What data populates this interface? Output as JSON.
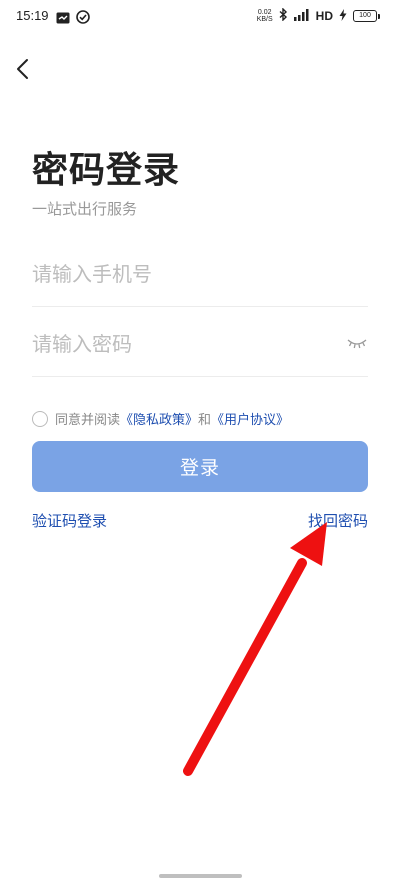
{
  "status_bar": {
    "time": "15:19",
    "net_speed_value": "0.02",
    "net_speed_unit": "KB/S",
    "network": "HD",
    "battery": "100",
    "icons": [
      "message-icon",
      "check-circle-icon",
      "bluetooth-icon",
      "signal-icon",
      "charging-icon"
    ]
  },
  "header": {
    "back_icon": "chevron-left-icon"
  },
  "page": {
    "title": "密码登录",
    "subtitle": "一站式出行服务"
  },
  "form": {
    "phone_placeholder": "请输入手机号",
    "password_placeholder": "请输入密码",
    "password_toggle_icon": "eye-closed-icon"
  },
  "agreement": {
    "prefix": "同意并阅读",
    "privacy_link": "《隐私政策》",
    "conjunction": "和",
    "terms_link": "《用户协议》"
  },
  "actions": {
    "login_label": "登录",
    "sms_login_label": "验证码登录",
    "forgot_password_label": "找回密码"
  },
  "colors": {
    "accent": "#7aa3e5",
    "link": "#1f4fb0",
    "annotation_arrow": "#ee1111"
  }
}
